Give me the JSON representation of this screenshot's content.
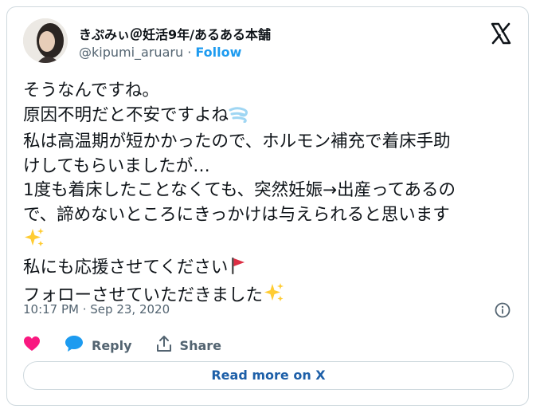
{
  "author": {
    "name": "きぷみぃ＠妊活9年/あるある本舗",
    "handle": "@kipumi_aruaru",
    "separator": "·",
    "follow_label": "Follow"
  },
  "tweet": {
    "line1": "そうなんですね。",
    "line2": "原因不明だと不安ですよね",
    "line3": "私は高温期が短かかったので、ホルモン補充で着床手助",
    "line4": "けしてもらいましたが…",
    "line5": "1度も着床したことなくても、突然妊娠→出産ってあるの",
    "line6": "で、諦めないところにきっかけは与えられると思います",
    "line8": "私にも応援させてください",
    "line9": "フォローさせていただきました"
  },
  "timestamp": "10:17 PM · Sep 23, 2020",
  "actions": {
    "reply_label": "Reply",
    "share_label": "Share"
  },
  "read_more_label": "Read more on X",
  "colors": {
    "link": "#1d9bf0",
    "heart": "#f91880",
    "reply_icon": "#1d9bf0",
    "muted": "#536471",
    "border": "#cfd9de"
  },
  "icons": [
    "x-logo",
    "dash-emoji",
    "sparkles-emoji",
    "red-flag-emoji",
    "info-icon",
    "heart-icon",
    "reply-bubble-icon",
    "share-icon"
  ]
}
